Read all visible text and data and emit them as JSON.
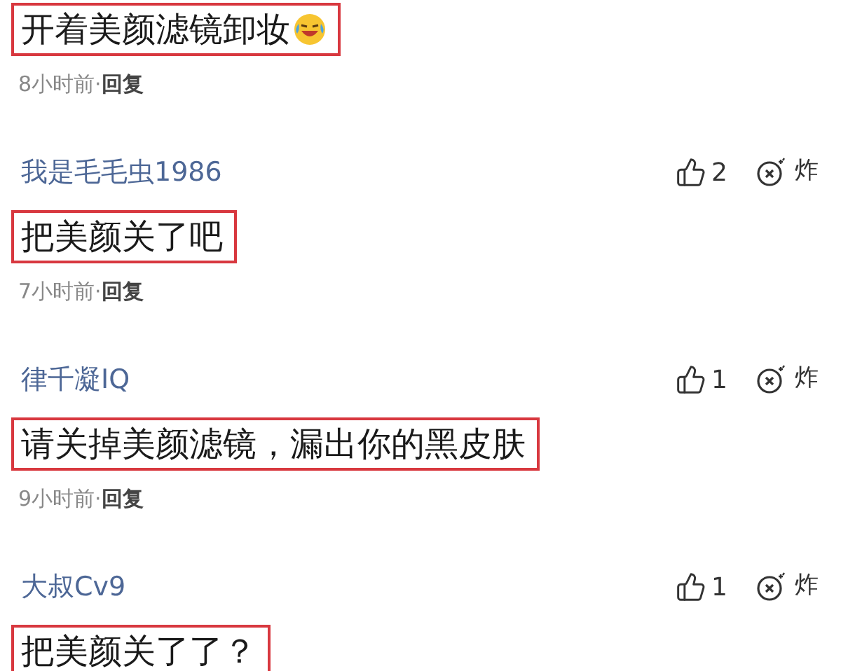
{
  "comments": [
    {
      "text": "开着美颜滤镜卸妆",
      "emoji": true,
      "highlighted": true,
      "time": "8小时前",
      "dot": "·",
      "reply": "回复"
    },
    {
      "author": "我是毛毛虫1986",
      "likes": "2",
      "bomb": "炸",
      "text": "把美颜关了吧",
      "emoji": false,
      "highlighted": true,
      "time": "7小时前",
      "dot": "·",
      "reply": "回复"
    },
    {
      "author": "律千凝IQ",
      "likes": "1",
      "bomb": "炸",
      "text": "请关掉美颜滤镜，漏出你的黑皮肤",
      "emoji": false,
      "highlighted": true,
      "time": "9小时前",
      "dot": "·",
      "reply": "回复"
    },
    {
      "author": "大叔Cv9",
      "likes": "1",
      "bomb": "炸",
      "text": "把美颜关了了？",
      "emoji": false,
      "highlighted": true
    }
  ]
}
